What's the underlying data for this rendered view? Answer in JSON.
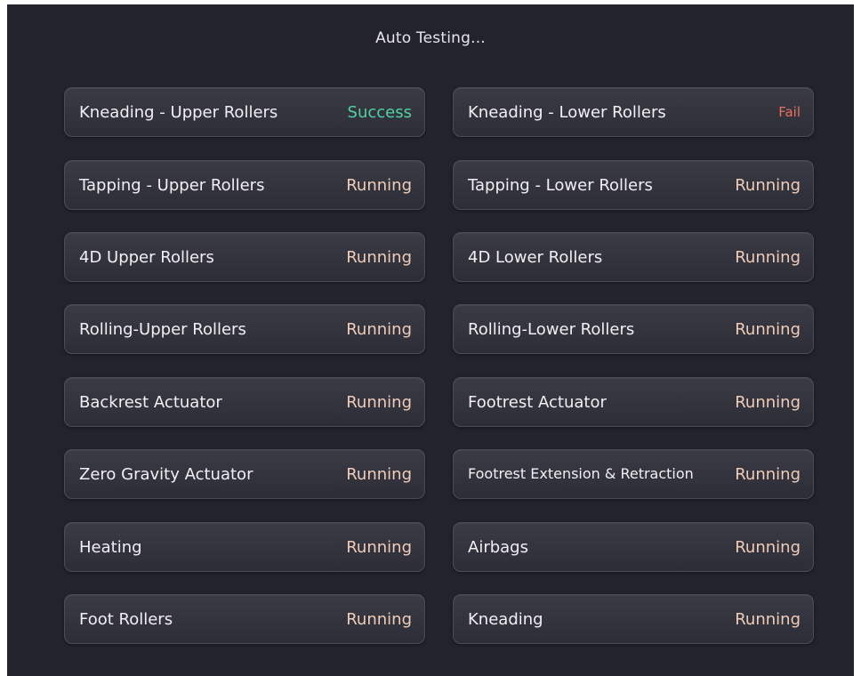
{
  "title": "Auto Testing...",
  "colors": {
    "background": "#23232d",
    "running": "#f0cdb9",
    "success": "#4fd3a2",
    "fail": "#e8705c"
  },
  "tests": {
    "left": [
      {
        "label": "Kneading - Upper Rollers",
        "status": "Success"
      },
      {
        "label": "Tapping - Upper Rollers",
        "status": "Running"
      },
      {
        "label": "4D Upper Rollers",
        "status": "Running"
      },
      {
        "label": "Rolling-Upper Rollers",
        "status": "Running"
      },
      {
        "label": "Backrest Actuator",
        "status": "Running"
      },
      {
        "label": "Zero Gravity Actuator",
        "status": "Running"
      },
      {
        "label": "Heating",
        "status": "Running"
      },
      {
        "label": "Foot Rollers",
        "status": "Running"
      }
    ],
    "right": [
      {
        "label": "Kneading - Lower Rollers",
        "status": "Fail"
      },
      {
        "label": "Tapping - Lower Rollers",
        "status": "Running"
      },
      {
        "label": "4D Lower Rollers",
        "status": "Running"
      },
      {
        "label": "Rolling-Lower Rollers",
        "status": "Running"
      },
      {
        "label": "Footrest Actuator",
        "status": "Running"
      },
      {
        "label": "Footrest Extension & Retraction",
        "status": "Running"
      },
      {
        "label": "Airbags",
        "status": "Running"
      },
      {
        "label": "Kneading",
        "status": "Running"
      }
    ]
  }
}
